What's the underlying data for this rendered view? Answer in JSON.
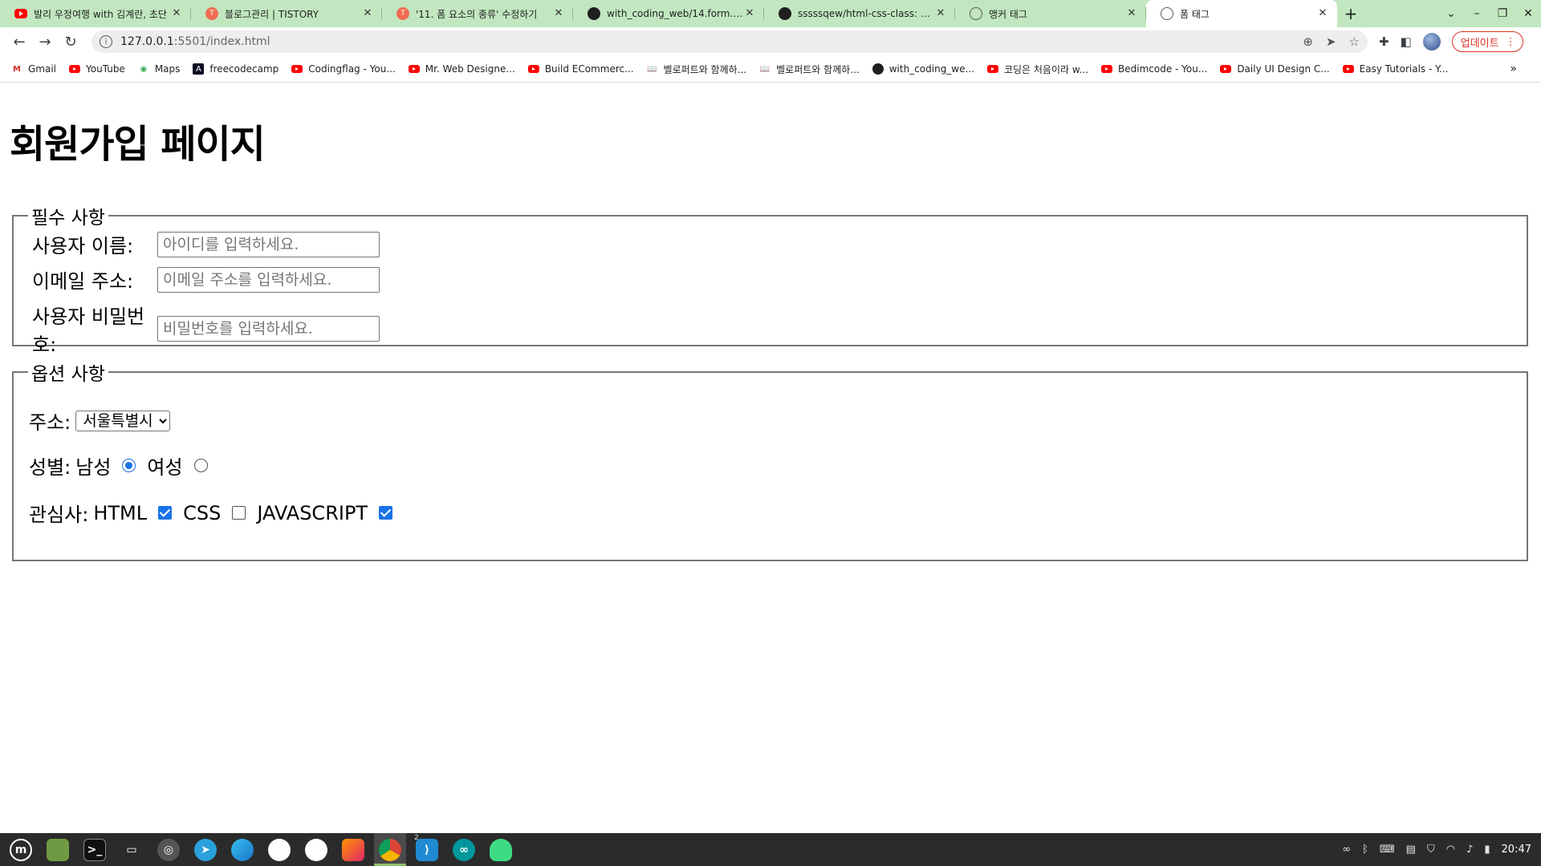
{
  "tabs": [
    {
      "title": "발리 우정여행 with 김계란, 초단",
      "favicon": "youtube-icon"
    },
    {
      "title": "블로그관리 | TISTORY",
      "favicon": "tistory-icon"
    },
    {
      "title": "'11. 폼 요소의 종류' 수정하기",
      "favicon": "tistory-icon"
    },
    {
      "title": "with_coding_web/14.form.htm",
      "favicon": "github-icon"
    },
    {
      "title": "sssssqew/html-css-class: htm",
      "favicon": "github-icon"
    },
    {
      "title": "앵커 태그",
      "favicon": "globe-icon"
    },
    {
      "title": "폼 태그",
      "favicon": "globe-icon",
      "active": true
    }
  ],
  "address_bar": {
    "host": "127.0.0.1",
    "path": ":5501/index.html"
  },
  "update_button": "업데이트",
  "bookmarks": [
    {
      "label": "Gmail",
      "icon": "gmail-icon"
    },
    {
      "label": "YouTube",
      "icon": "youtube-icon"
    },
    {
      "label": "Maps",
      "icon": "maps-icon"
    },
    {
      "label": "freecodecamp",
      "icon": "freecodecamp-icon"
    },
    {
      "label": "Codingflag - You...",
      "icon": "youtube-icon"
    },
    {
      "label": "Mr. Web Designe...",
      "icon": "youtube-icon"
    },
    {
      "label": "Build ECommerc...",
      "icon": "youtube-icon"
    },
    {
      "label": "벨로퍼트와 함께하...",
      "icon": "book-icon"
    },
    {
      "label": "벨로퍼트와 함께하...",
      "icon": "book-icon"
    },
    {
      "label": "with_coding_we...",
      "icon": "github-icon"
    },
    {
      "label": "코딩은 처음이라 w...",
      "icon": "youtube-icon"
    },
    {
      "label": "Bedimcode - You...",
      "icon": "youtube-icon"
    },
    {
      "label": "Daily UI Design C...",
      "icon": "youtube-icon"
    },
    {
      "label": "Easy Tutorials - Y...",
      "icon": "youtube-icon"
    }
  ],
  "page": {
    "heading": "회원가입 페이지",
    "required": {
      "legend": "필수 사항",
      "username_label": "사용자 이름:",
      "username_placeholder": "아이디를 입력하세요.",
      "email_label": "이메일 주소:",
      "email_placeholder": "이메일 주소를 입력하세요.",
      "password_label": "사용자 비밀번호:",
      "password_placeholder": "비밀번호를 입력하세요."
    },
    "optional": {
      "legend": "옵션 사항",
      "address_label": "주소:",
      "address_selected": "서울특별시",
      "gender_label": "성별:",
      "gender_male": "남성",
      "gender_female": "여성",
      "gender_checked": "male",
      "interest_label": "관심사:",
      "interests": [
        {
          "label": "HTML",
          "checked": true
        },
        {
          "label": "CSS",
          "checked": false
        },
        {
          "label": "JAVASCRIPT",
          "checked": true
        }
      ]
    }
  },
  "taskbar": {
    "vscode_badge": "2",
    "clock": "20:47"
  }
}
